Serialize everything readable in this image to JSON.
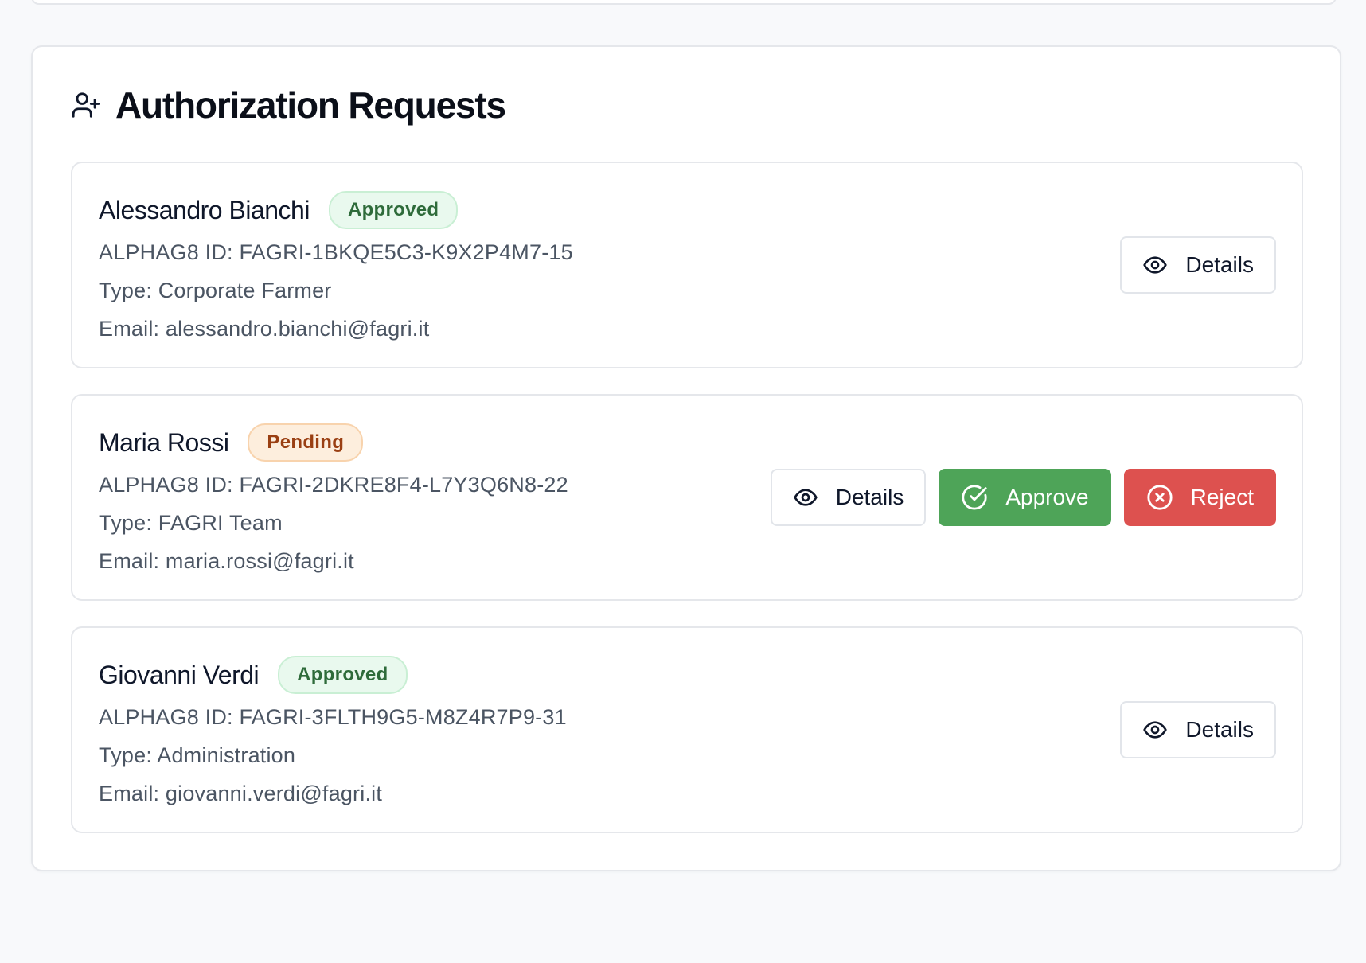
{
  "section": {
    "title": "Authorization Requests",
    "icon": "user-plus-icon"
  },
  "requests": [
    {
      "name": "Alessandro Bianchi",
      "status": "Approved",
      "alphag8_id": "ALPHAG8 ID: FAGRI-1BKQE5C3-K9X2P4M7-15",
      "type": "Type: Corporate Farmer",
      "email": "Email: alessandro.bianchi@fagri.it",
      "actions": {
        "details": "Details"
      }
    },
    {
      "name": "Maria Rossi",
      "status": "Pending",
      "alphag8_id": "ALPHAG8 ID: FAGRI-2DKRE8F4-L7Y3Q6N8-22",
      "type": "Type: FAGRI Team",
      "email": "Email: maria.rossi@fagri.it",
      "actions": {
        "details": "Details",
        "approve": "Approve",
        "reject": "Reject"
      }
    },
    {
      "name": "Giovanni Verdi",
      "status": "Approved",
      "alphag8_id": "ALPHAG8 ID: FAGRI-3FLTH9G5-M8Z4R7P9-31",
      "type": "Type: Administration",
      "email": "Email: giovanni.verdi@fagri.it",
      "actions": {
        "details": "Details"
      }
    }
  ],
  "colors": {
    "approved_badge_bg": "#e9f9ee",
    "approved_badge_text": "#2e6b3a",
    "pending_badge_bg": "#fdeedd",
    "pending_badge_text": "#9a3f12",
    "approve_button": "#4ea458",
    "reject_button": "#dd514f"
  }
}
